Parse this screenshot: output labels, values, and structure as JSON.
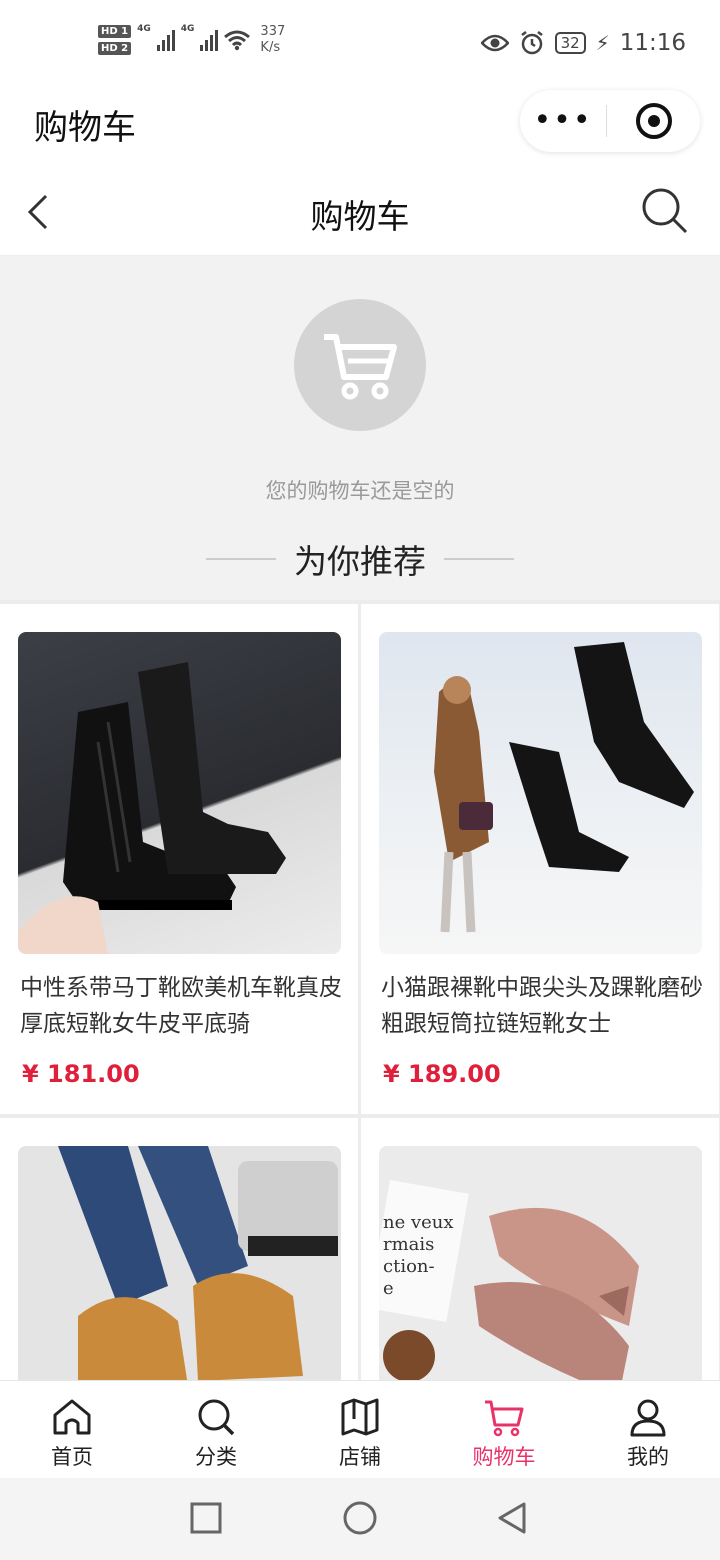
{
  "status_bar": {
    "hd1": "HD 1",
    "hd2": "HD 2",
    "net1": "4G",
    "net2": "4G",
    "speed_value": "337",
    "speed_unit": "K/s",
    "battery": "32",
    "time": "11:16"
  },
  "mp_header": {
    "title": "购物车",
    "more_label": "•••"
  },
  "nav": {
    "title": "购物车"
  },
  "empty_state": {
    "message": "您的购物车还是空的",
    "recommend_title": "为你推荐"
  },
  "products": [
    {
      "name": "中性系带马丁靴欧美机车靴真皮厚底短靴女牛皮平底骑",
      "price": "¥ 181.00"
    },
    {
      "name": "小猫跟裸靴中跟尖头及踝靴磨砂粗跟短筒拉链短靴女士",
      "price": "¥ 189.00"
    },
    {
      "name": "",
      "price": ""
    },
    {
      "name": "",
      "price": ""
    }
  ],
  "image_text": {
    "bottom_right_script": "ne veux\nrmais\nction-\ne"
  },
  "tabs": [
    {
      "label": "首页",
      "icon": "home-icon"
    },
    {
      "label": "分类",
      "icon": "search-icon"
    },
    {
      "label": "店铺",
      "icon": "map-icon"
    },
    {
      "label": "购物车",
      "icon": "cart-icon"
    },
    {
      "label": "我的",
      "icon": "user-icon"
    }
  ],
  "colors": {
    "accent": "#e8336a",
    "price": "#e0203a"
  }
}
